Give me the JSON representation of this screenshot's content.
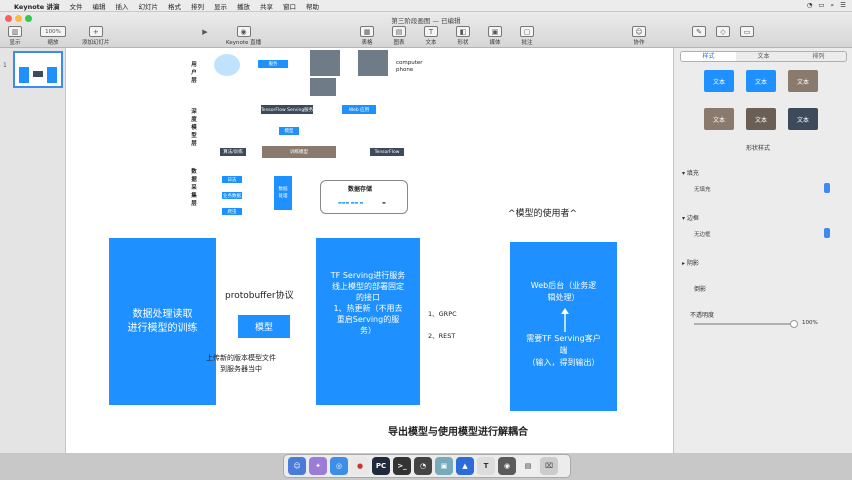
{
  "menubar": {
    "app_name": "Keynote 讲演",
    "items": [
      "文件",
      "编辑",
      "插入",
      "幻灯片",
      "格式",
      "排列",
      "显示",
      "播放",
      "共享",
      "窗口",
      "帮助"
    ]
  },
  "window": {
    "title": "第三阶段画图 — 已编辑"
  },
  "toolbar": {
    "display": "显示",
    "zoom": "100%",
    "zoom_label": "缩放",
    "add_slide": "添加幻灯片",
    "keynote_live": "Keynote 直播",
    "table": "表格",
    "chart": "图表",
    "text": "文本",
    "shape": "形状",
    "media": "媒体",
    "comment": "批注",
    "collaborate": "协作"
  },
  "navigator": {
    "slide_number": "1"
  },
  "inspector": {
    "tabs": [
      "样式",
      "文本",
      "排列"
    ],
    "swatch_label": "文本",
    "shape_styles": "形状样式",
    "fill_label": "填充",
    "fill_value": "无填充",
    "border_label": "边框",
    "border_value": "无边框",
    "shadow_label": "阴影",
    "reflection_label": "倒影",
    "opacity_label": "不透明度",
    "opacity_value": "100%"
  },
  "colors": {
    "accent": "#1e90ff",
    "dark_box": "#3c4a5a",
    "brown_box": "#8a7a6e"
  },
  "diagram": {
    "layer_user": "用户层",
    "layer_model": "深度模型层",
    "layer_data": "数据采集层",
    "box_service": "服务",
    "computer_phone": "computer\nphone",
    "box_serving_server": "TensorFlow Serving服务",
    "box_web_app": "Web 应用",
    "box_model": "模型",
    "box_algorithm": "算法/训练",
    "box_training": "训练模型",
    "box_tensorflow": "TensorFlow",
    "data_storage": "数据存储",
    "small_left_1": "日志",
    "small_left_2": "业务数据",
    "small_left_3": "爬虫",
    "data_proc": "数据\n处理",
    "storage_row": "▬▬▬ ▬▬ ▬",
    "storage_dash": "▬"
  },
  "main": {
    "model_users": "^模型的使用者^",
    "box1": "数据处理读取\n进行模型的训练",
    "protobuffer": "protobuffer协议",
    "model_box": "模型",
    "upload_note": "上传新的版本模型文件\n到服务器当中",
    "box3": "TF Serving进行服务\n线上模型的部署固定\n的接口\n1、热更新（不用去\n重启Serving的服\n务）",
    "grpc": "1、GRPC",
    "rest": "2、REST",
    "box4_top": "Web后台（业务逻\n辑处理）",
    "box4_bottom": "需要TF Serving客户\n端\n（输入，得到输出）",
    "footer": "导出模型与使用模型进行解耦合"
  }
}
